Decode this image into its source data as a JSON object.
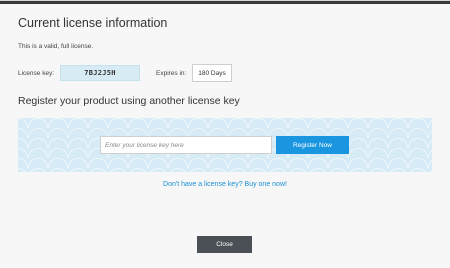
{
  "license": {
    "heading": "Current license information",
    "status_text": "This is a valid, full license.",
    "key_label": "License key:",
    "key_value": "7BJ2J5H",
    "expires_label": "Expires in:",
    "expires_value": "180 Days"
  },
  "register": {
    "heading": "Register your product using another license key",
    "input_placeholder": "Enter your license key here",
    "input_value": "",
    "button_label": "Register Now",
    "buy_link": "Don't have a license key? Buy one now!"
  },
  "footer": {
    "close_label": "Close"
  },
  "colors": {
    "accent": "#1a96e0",
    "link": "#1a8fd6",
    "panel_bg": "#d6ebf6",
    "close_button": "#4a5056"
  }
}
